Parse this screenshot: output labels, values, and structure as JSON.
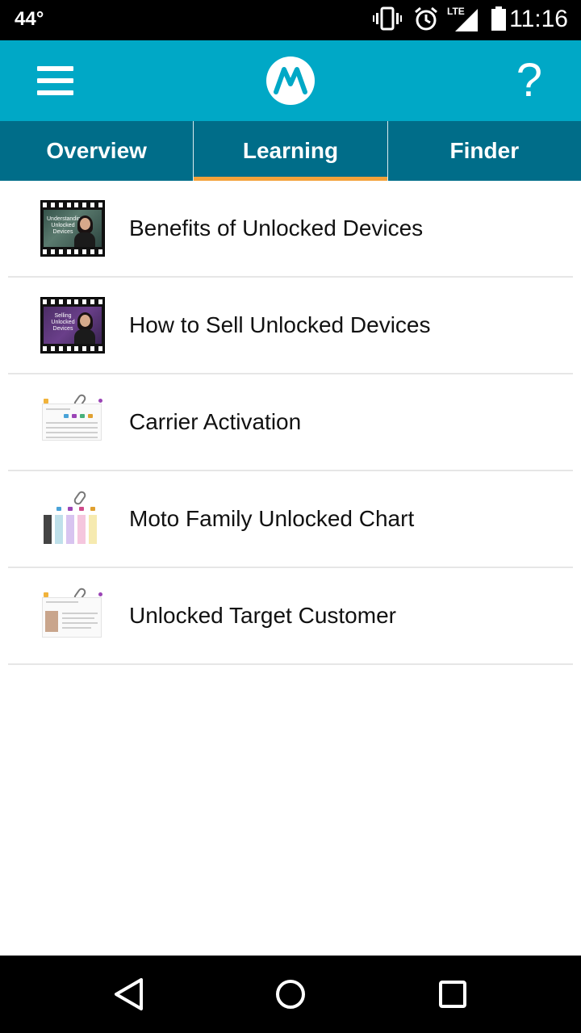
{
  "status_bar": {
    "temperature": "44°",
    "time": "11:16",
    "network_label": "LTE",
    "icons": [
      "vibrate-icon",
      "alarm-icon",
      "signal-icon",
      "battery-icon"
    ]
  },
  "app_bar": {
    "menu_icon": "hamburger-menu-icon",
    "logo": "motorola-logo",
    "help_label": "?"
  },
  "tabs": [
    {
      "label": "Overview",
      "active": false
    },
    {
      "label": "Learning",
      "active": true
    },
    {
      "label": "Finder",
      "active": false
    }
  ],
  "items": [
    {
      "label": "Benefits of Unlocked Devices",
      "thumb": "video-thumbnail",
      "thumb_caption": "Understanding Unlocked Devices"
    },
    {
      "label": "How to Sell Unlocked Devices",
      "thumb": "video-thumbnail",
      "thumb_caption": "Selling Unlocked Devices"
    },
    {
      "label": "Carrier Activation",
      "thumb": "document-thumbnail"
    },
    {
      "label": "Moto Family Unlocked Chart",
      "thumb": "document-thumbnail"
    },
    {
      "label": "Unlocked Target Customer",
      "thumb": "document-thumbnail"
    }
  ],
  "nav_bar": {
    "icons": [
      "back-icon",
      "home-icon",
      "recents-icon"
    ]
  },
  "colors": {
    "app_bar": "#00a8c6",
    "tab_bar": "#006d89",
    "tab_indicator": "#f4a23a",
    "divider": "#e6e6e6"
  }
}
